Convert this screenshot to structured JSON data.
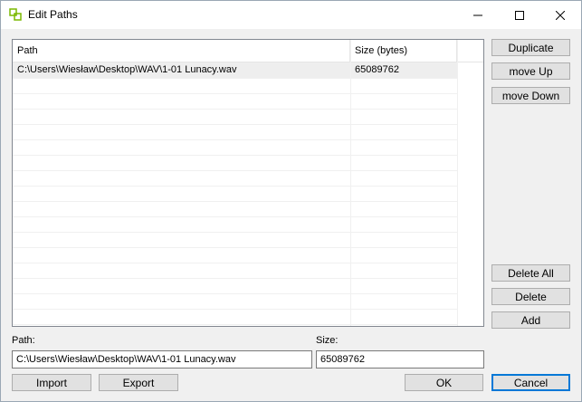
{
  "window": {
    "title": "Edit Paths",
    "accent": "#0078d7"
  },
  "table": {
    "columns": [
      "Path",
      "Size (bytes)"
    ],
    "rows": [
      {
        "path": "C:\\Users\\Wiesław\\Desktop\\WAV\\1-01 Lunacy.wav",
        "size": "65089762"
      }
    ]
  },
  "side_buttons": {
    "duplicate": "Duplicate",
    "move_up": "move Up",
    "move_down": "move Down",
    "delete_all": "Delete All",
    "delete": "Delete",
    "add": "Add"
  },
  "form": {
    "path_label": "Path:",
    "path_value": "C:\\Users\\Wiesław\\Desktop\\WAV\\1-01 Lunacy.wav",
    "size_label": "Size:",
    "size_value": "65089762"
  },
  "bottom_buttons": {
    "import": "Import",
    "export": "Export",
    "ok": "OK",
    "cancel": "Cancel"
  },
  "icons": {
    "app": "app-icon",
    "minimize": "minimize-icon",
    "maximize": "maximize-icon",
    "close": "close-icon"
  }
}
